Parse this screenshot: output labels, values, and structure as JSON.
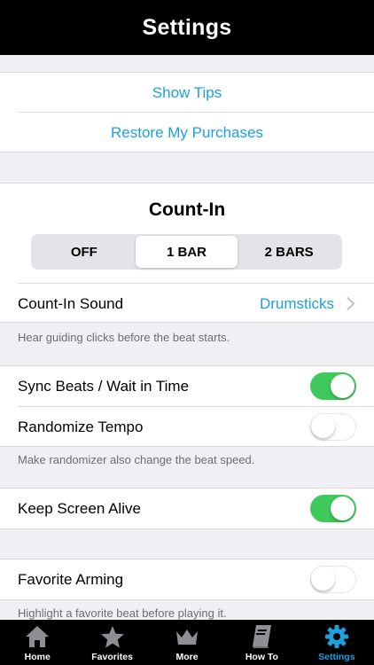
{
  "header": {
    "title": "Settings"
  },
  "links": {
    "show_tips": "Show Tips",
    "restore": "Restore My Purchases"
  },
  "count_in": {
    "title": "Count-In",
    "options": [
      "OFF",
      "1 BAR",
      "2 BARS"
    ],
    "selected": "1 BAR",
    "sound_label": "Count-In Sound",
    "sound_value": "Drumsticks",
    "note": "Hear guiding clicks before the beat starts."
  },
  "sync": {
    "label": "Sync Beats / Wait in Time",
    "on": true
  },
  "randomize": {
    "label": "Randomize Tempo",
    "on": false,
    "note": "Make randomizer also change the beat speed."
  },
  "keep_alive": {
    "label": "Keep Screen Alive",
    "on": true
  },
  "favorite": {
    "label": "Favorite Arming",
    "on": false,
    "note": "Highlight a favorite beat before playing it."
  },
  "tabs": [
    {
      "label": "Home",
      "icon": "home-icon"
    },
    {
      "label": "Favorites",
      "icon": "star-icon"
    },
    {
      "label": "More",
      "icon": "crown-icon"
    },
    {
      "label": "How To",
      "icon": "book-icon"
    },
    {
      "label": "Settings",
      "icon": "gear-icon",
      "active": true
    }
  ],
  "colors": {
    "accent": "#1ca1dd",
    "toggle_on": "#3fc85b",
    "bar": "#000000"
  }
}
